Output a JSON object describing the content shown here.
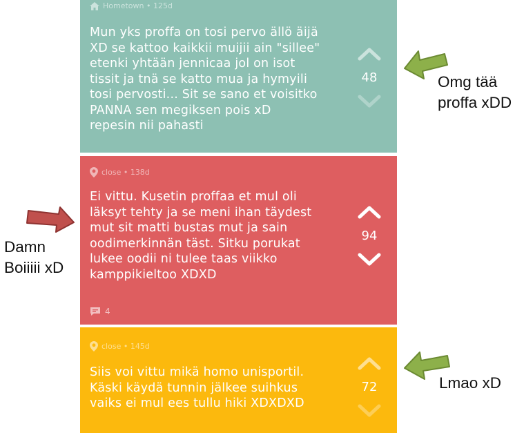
{
  "posts": [
    {
      "meta": "Hometown • 125d",
      "meta_icon": "home-icon",
      "text": "Mun yks proffa on tosi pervo ällö äijä\nXD se kattoo kaikkii muijii ain \"sillee\"\netenki yhtään jennicaa jol on isot\ntissit ja tnä se katto mua ja hymyili\ntosi pervosti... Sit se sano et voisitko\nPANNA sen megiksen pois xD\nrepesin nii pahasti",
      "votes": "48",
      "color": "#8dc0b3"
    },
    {
      "meta": "close • 138d",
      "meta_icon": "location-pin-icon",
      "text": "Ei vittu. Kusetin proffaa et mul oli\nläksyt tehty ja se meni ihan täydest\nmut sit matti bustas mut ja sain\noodimerkinnän täst. Sitku porukat\nlukee oodii ni tulee taas viikko\nkamppikieltoo XDXD",
      "votes": "94",
      "comments": "4",
      "color": "#de5e60"
    },
    {
      "meta": "close • 145d",
      "meta_icon": "location-pin-icon",
      "text": "Siis voi vittu mikä homo unisportil.\nKäski käydä tunnin jälkee suihkus\nvaiks ei mul ees tullu hiki XDXDXD",
      "votes": "72",
      "color": "#fcb90d"
    }
  ],
  "annotations": {
    "first": "Omg tää\nproffa xDD",
    "second": "Damn\nBoiiiii xD",
    "third": "Lmao xD"
  },
  "colors": {
    "arrow_green": "#8db04a",
    "arrow_red": "#c0504d"
  }
}
